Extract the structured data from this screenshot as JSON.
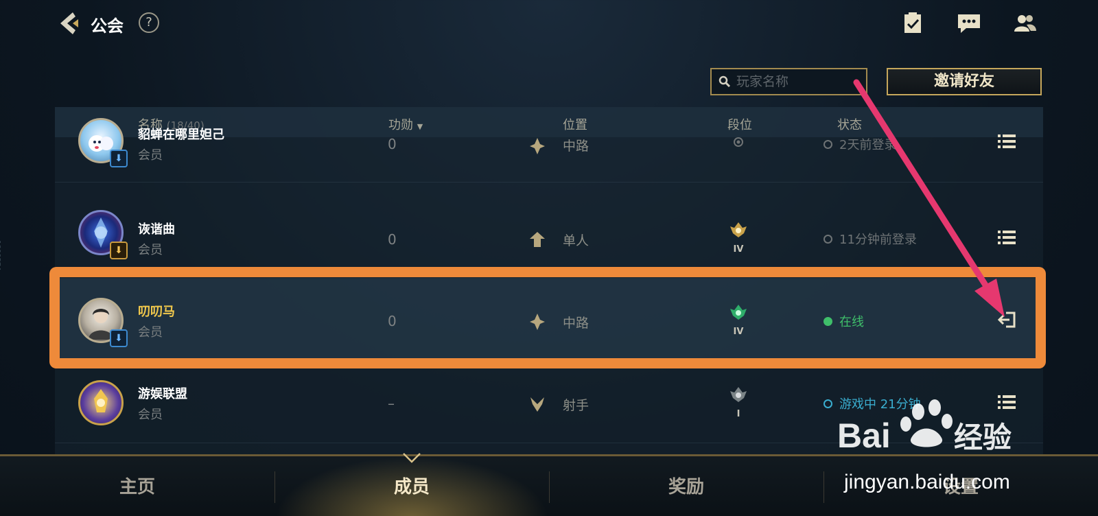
{
  "header": {
    "title": "公会",
    "help": "?"
  },
  "toolbar": {
    "search_placeholder": "玩家名称",
    "invite_label": "邀请好友"
  },
  "table": {
    "columns": {
      "name": "名称",
      "count": "(18/40)",
      "merit": "功勋",
      "position": "位置",
      "rank": "段位",
      "status": "状态"
    },
    "rows": [
      {
        "name": "貂蝉在哪里妲己",
        "role": "会员",
        "merit": "0",
        "position": "中路",
        "status": "2天前登录",
        "state": "offline"
      },
      {
        "name": "诙谐曲",
        "role": "会员",
        "merit": "0",
        "position": "单人",
        "rank_tier": "IV",
        "status": "11分钟前登录",
        "state": "offline"
      },
      {
        "name": "叨叨马",
        "role": "会员",
        "merit": "0",
        "position": "中路",
        "rank_tier": "IV",
        "status": "在线",
        "state": "online"
      },
      {
        "name": "游娱联盟",
        "role": "会员",
        "merit": "–",
        "position": "射手",
        "rank_tier": "I",
        "status": "游戏中 21分钟",
        "state": "ingame"
      }
    ]
  },
  "tabs": [
    "主页",
    "成员",
    "奖励",
    "设置"
  ],
  "active_tab": "成员",
  "colors": {
    "highlight": "#ee8a3a",
    "arrow": "#e6386f",
    "gold": "#c7a85c",
    "online": "#3fbf6a"
  },
  "side_id": "1800574",
  "watermark": {
    "logo": "Bai du 经验",
    "url": "jingyan.baidu.com"
  }
}
